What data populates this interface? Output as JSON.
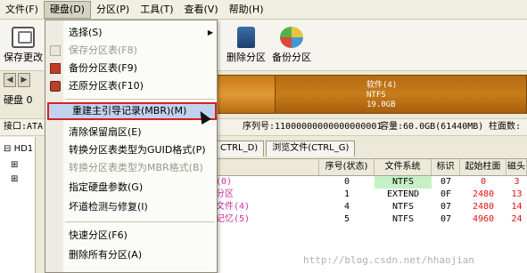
{
  "menubar": {
    "items": [
      "文件(F)",
      "硬盘(D)",
      "分区(P)",
      "工具(T)",
      "查看(V)",
      "帮助(H)"
    ],
    "active_index": 1
  },
  "toolbar": {
    "save_label": "保存更改",
    "delete_label": "删除分区",
    "backup_label": "备份分区"
  },
  "disk": {
    "label": "硬盘 0",
    "partition_text": [
      "软件(4)",
      "NTFS",
      "19.0GB"
    ]
  },
  "infobar": {
    "interface": "接口:ATA",
    "serial": "序列号:11000000000000000001",
    "capacity": "容量:60.0GB(61440MB)",
    "cylinders": "柱面数:"
  },
  "tree": {
    "root": "HD1",
    "expand_symbol": "⊟",
    "child_symbol": "⊞"
  },
  "tabs": [
    "CTRL_D)",
    "浏览文件(CTRL_G)"
  ],
  "table": {
    "headers": [
      "",
      "序号(状态)",
      "文件系统",
      "标识",
      "起始柱面",
      "磁头"
    ],
    "rows": [
      [
        "(0)",
        "0",
        "NTFS",
        "07",
        "0",
        "3"
      ],
      [
        "分区",
        "1",
        "EXTEND",
        "0F",
        "2480",
        "13"
      ],
      [
        "文件(4)",
        "4",
        "NTFS",
        "07",
        "2480",
        "14"
      ],
      [
        "记忆(5)",
        "5",
        "NTFS",
        "07",
        "4960",
        "24"
      ]
    ]
  },
  "dropdown": {
    "items": [
      {
        "label": "选择(S)",
        "state": "normal",
        "submenu": true
      },
      {
        "label": "保存分区表(F8)",
        "state": "disabled"
      },
      {
        "label": "备份分区表(F9)",
        "state": "normal"
      },
      {
        "label": "还原分区表(F10)",
        "state": "normal"
      },
      {
        "label": "重建主引导记录(MBR)(M)",
        "state": "selected"
      },
      {
        "label": "清除保留扇区(E)",
        "state": "normal"
      },
      {
        "label": "转换分区表类型为GUID格式(P)",
        "state": "normal"
      },
      {
        "label": "转换分区表类型为MBR格式(B)",
        "state": "disabled"
      },
      {
        "label": "指定硬盘参数(G)",
        "state": "normal"
      },
      {
        "label": "坏道检测与修复(I)",
        "state": "normal"
      },
      {
        "label": "快速分区(F6)",
        "state": "normal"
      },
      {
        "label": "删除所有分区(A)",
        "state": "normal"
      }
    ]
  },
  "watermark": "http://blog.csdn.net/hhaojian"
}
